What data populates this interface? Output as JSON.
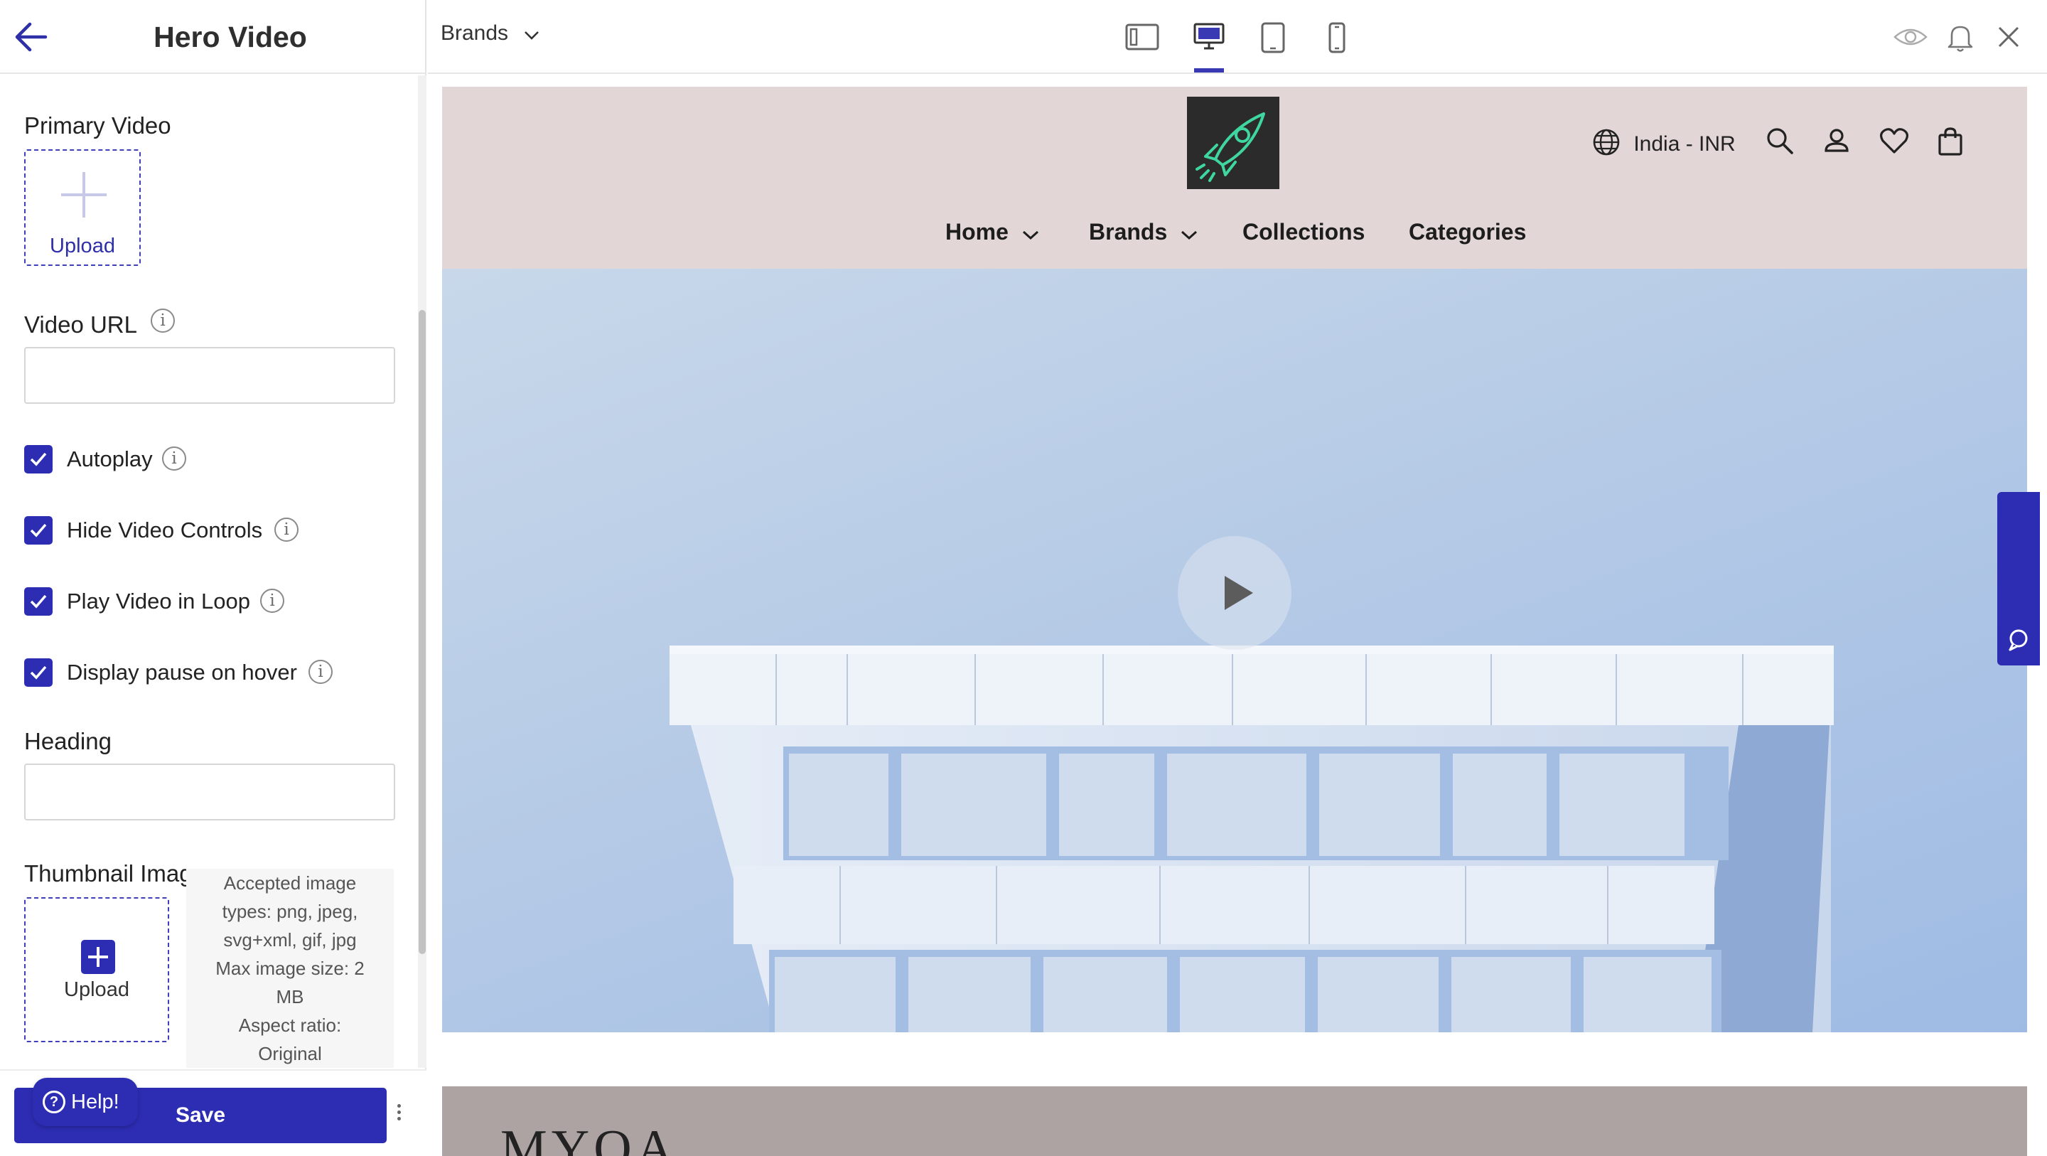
{
  "sidebar": {
    "title": "Hero Video",
    "primary_video_label": "Primary Video",
    "upload_label": "Upload",
    "video_url_label": "Video URL",
    "video_url_value": "",
    "checkboxes": [
      {
        "label": "Autoplay",
        "checked": true
      },
      {
        "label": "Hide Video Controls",
        "checked": true
      },
      {
        "label": "Play Video in Loop",
        "checked": true
      },
      {
        "label": "Display pause on hover",
        "checked": true
      }
    ],
    "heading_label": "Heading",
    "heading_value": "",
    "thumbnail_label": "Thumbnail Image",
    "thumbnail_upload_label": "Upload",
    "thumbnail_info_lines": [
      "Accepted image",
      "types: png, jpeg,",
      "svg+xml, gif, jpg",
      "Max image size: 2",
      "MB",
      "Aspect ratio:",
      "Original"
    ],
    "save_label": "Save",
    "help_label": "Help!"
  },
  "toolbar": {
    "page_select": "Brands",
    "devices": [
      "sidebar-layout-icon",
      "desktop-icon",
      "tablet-icon",
      "mobile-icon"
    ],
    "active_device": "desktop-icon",
    "actions": [
      "eye-icon",
      "bell-icon",
      "close-icon"
    ]
  },
  "site": {
    "region": "India - INR",
    "nav": [
      "Home",
      "Brands",
      "Collections",
      "Categories"
    ],
    "header_icons": [
      "search-icon",
      "account-icon",
      "wishlist-icon",
      "cart-icon"
    ],
    "footer_text": "MYOA",
    "colors": {
      "header_bg": "#e2d6d6",
      "footer_bg": "#aea3a3",
      "accent": "#2d2db4"
    }
  },
  "feedback_label": "Feedback"
}
